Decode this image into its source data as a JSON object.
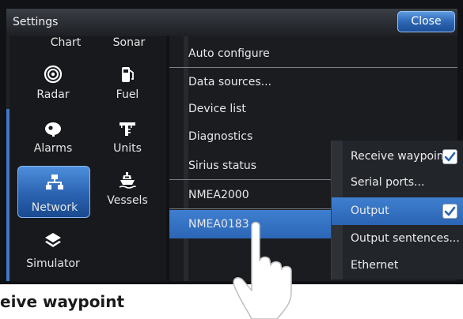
{
  "window": {
    "title": "Settings",
    "close_label": "Close"
  },
  "categories": [
    {
      "label": "Chart",
      "icon": "chart-icon"
    },
    {
      "label": "Sonar",
      "icon": "sonar-icon"
    },
    {
      "label": "Radar",
      "icon": "radar-icon"
    },
    {
      "label": "Fuel",
      "icon": "fuel-pump-icon"
    },
    {
      "label": "Alarms",
      "icon": "alarm-bell-icon"
    },
    {
      "label": "Units",
      "icon": "units-ruler-icon"
    },
    {
      "label": "Network",
      "icon": "network-icon",
      "selected": true
    },
    {
      "label": "Vessels",
      "icon": "vessels-icon"
    },
    {
      "label": "Simulator",
      "icon": "simulator-layers-icon"
    }
  ],
  "menu": [
    {
      "label": "Auto configure"
    },
    {
      "label": "Data sources..."
    },
    {
      "label": "Device list"
    },
    {
      "label": "Diagnostics"
    },
    {
      "label": "Sirius status"
    },
    {
      "label": "NMEA2000"
    },
    {
      "label": "NMEA0183",
      "selected": true
    }
  ],
  "submenu": [
    {
      "label": "Receive waypoint",
      "checked": true
    },
    {
      "label": "Serial ports..."
    },
    {
      "label": "Output",
      "checked": true,
      "selected": true
    },
    {
      "label": "Output sentences..."
    },
    {
      "label": "Ethernet"
    }
  ],
  "caption": "eive waypoint",
  "colors": {
    "accent": "#2c66b6",
    "background": "#17191d"
  }
}
